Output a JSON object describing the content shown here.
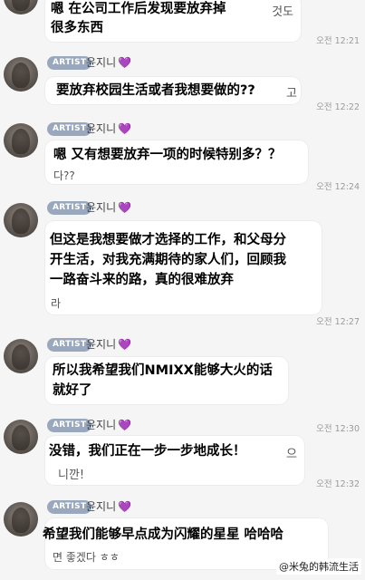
{
  "messages": [
    {
      "ko_text": "것도",
      "cn_text": [
        "嗯 在公司工作后发现要放弃掉",
        "很多东西"
      ],
      "time": "오전 12:21"
    },
    {
      "badge": "ARTIST",
      "author": "윤지니",
      "ko_text": "고",
      "cn_text": [
        "要放弃校园生活或者我想要做的??"
      ],
      "time": "오전 12:22"
    },
    {
      "badge": "ARTIST",
      "author": "윤지니",
      "ko_text": "다??",
      "cn_text": [
        "嗯 又有想要放弃一项的时候特别多？？"
      ],
      "time": "오전 12:24"
    },
    {
      "badge": "ARTIST",
      "author": "윤지니",
      "ko_text": "라",
      "cn_text": [
        "但这是我想要做才选择的工作，和父母分",
        "开生活，对我充满期待的家人们，回顾我",
        "一路奋斗来的路，真的很难放弃"
      ],
      "time": "오전 12:27"
    },
    {
      "badge": "ARTIST",
      "author": "윤지니",
      "cn_text": [
        "所以我希望我们NMIXX能够大火的话",
        "就好了"
      ],
      "time": "오전 12:30"
    },
    {
      "badge": "ARTIST",
      "author": "윤지니",
      "ko_text": "으",
      "ko_text2": "니깐!",
      "cn_text": [
        " 没错，我们正在一步一步地成长！"
      ],
      "time": "오전 12:32"
    },
    {
      "badge": "ARTIST",
      "author": "윤지니",
      "ko_text": "면 좋겠다 ㅎㅎ",
      "cn_text": [
        "希望我们能够早点成为闪耀的星星 哈哈哈"
      ]
    }
  ],
  "heart": "💜",
  "watermark": "@米兔的韩流生活",
  "colors": {
    "badge": "#9aa8bd",
    "heart": "#8a3fd0",
    "background": "#f5f5f5"
  }
}
